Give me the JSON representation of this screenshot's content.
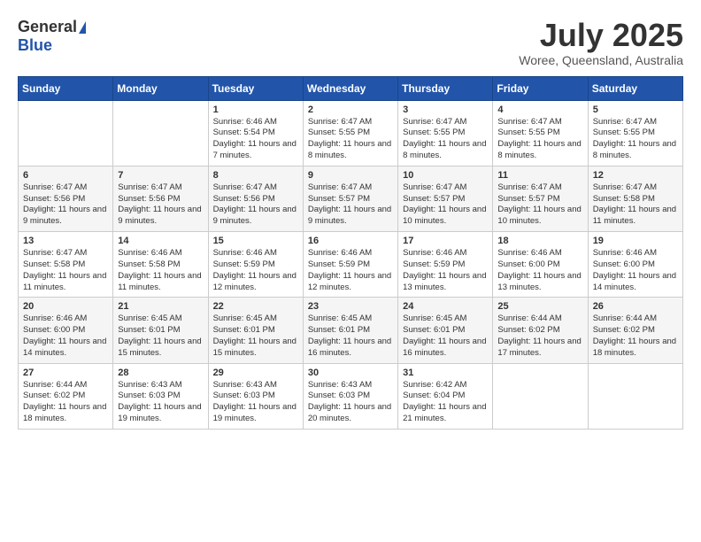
{
  "header": {
    "logo_general": "General",
    "logo_blue": "Blue",
    "month_year": "July 2025",
    "location": "Woree, Queensland, Australia"
  },
  "weekdays": [
    "Sunday",
    "Monday",
    "Tuesday",
    "Wednesday",
    "Thursday",
    "Friday",
    "Saturday"
  ],
  "weeks": [
    [
      {
        "day": "",
        "content": ""
      },
      {
        "day": "",
        "content": ""
      },
      {
        "day": "1",
        "content": "Sunrise: 6:46 AM\nSunset: 5:54 PM\nDaylight: 11 hours and 7 minutes."
      },
      {
        "day": "2",
        "content": "Sunrise: 6:47 AM\nSunset: 5:55 PM\nDaylight: 11 hours and 8 minutes."
      },
      {
        "day": "3",
        "content": "Sunrise: 6:47 AM\nSunset: 5:55 PM\nDaylight: 11 hours and 8 minutes."
      },
      {
        "day": "4",
        "content": "Sunrise: 6:47 AM\nSunset: 5:55 PM\nDaylight: 11 hours and 8 minutes."
      },
      {
        "day": "5",
        "content": "Sunrise: 6:47 AM\nSunset: 5:55 PM\nDaylight: 11 hours and 8 minutes."
      }
    ],
    [
      {
        "day": "6",
        "content": "Sunrise: 6:47 AM\nSunset: 5:56 PM\nDaylight: 11 hours and 9 minutes."
      },
      {
        "day": "7",
        "content": "Sunrise: 6:47 AM\nSunset: 5:56 PM\nDaylight: 11 hours and 9 minutes."
      },
      {
        "day": "8",
        "content": "Sunrise: 6:47 AM\nSunset: 5:56 PM\nDaylight: 11 hours and 9 minutes."
      },
      {
        "day": "9",
        "content": "Sunrise: 6:47 AM\nSunset: 5:57 PM\nDaylight: 11 hours and 9 minutes."
      },
      {
        "day": "10",
        "content": "Sunrise: 6:47 AM\nSunset: 5:57 PM\nDaylight: 11 hours and 10 minutes."
      },
      {
        "day": "11",
        "content": "Sunrise: 6:47 AM\nSunset: 5:57 PM\nDaylight: 11 hours and 10 minutes."
      },
      {
        "day": "12",
        "content": "Sunrise: 6:47 AM\nSunset: 5:58 PM\nDaylight: 11 hours and 11 minutes."
      }
    ],
    [
      {
        "day": "13",
        "content": "Sunrise: 6:47 AM\nSunset: 5:58 PM\nDaylight: 11 hours and 11 minutes."
      },
      {
        "day": "14",
        "content": "Sunrise: 6:46 AM\nSunset: 5:58 PM\nDaylight: 11 hours and 11 minutes."
      },
      {
        "day": "15",
        "content": "Sunrise: 6:46 AM\nSunset: 5:59 PM\nDaylight: 11 hours and 12 minutes."
      },
      {
        "day": "16",
        "content": "Sunrise: 6:46 AM\nSunset: 5:59 PM\nDaylight: 11 hours and 12 minutes."
      },
      {
        "day": "17",
        "content": "Sunrise: 6:46 AM\nSunset: 5:59 PM\nDaylight: 11 hours and 13 minutes."
      },
      {
        "day": "18",
        "content": "Sunrise: 6:46 AM\nSunset: 6:00 PM\nDaylight: 11 hours and 13 minutes."
      },
      {
        "day": "19",
        "content": "Sunrise: 6:46 AM\nSunset: 6:00 PM\nDaylight: 11 hours and 14 minutes."
      }
    ],
    [
      {
        "day": "20",
        "content": "Sunrise: 6:46 AM\nSunset: 6:00 PM\nDaylight: 11 hours and 14 minutes."
      },
      {
        "day": "21",
        "content": "Sunrise: 6:45 AM\nSunset: 6:01 PM\nDaylight: 11 hours and 15 minutes."
      },
      {
        "day": "22",
        "content": "Sunrise: 6:45 AM\nSunset: 6:01 PM\nDaylight: 11 hours and 15 minutes."
      },
      {
        "day": "23",
        "content": "Sunrise: 6:45 AM\nSunset: 6:01 PM\nDaylight: 11 hours and 16 minutes."
      },
      {
        "day": "24",
        "content": "Sunrise: 6:45 AM\nSunset: 6:01 PM\nDaylight: 11 hours and 16 minutes."
      },
      {
        "day": "25",
        "content": "Sunrise: 6:44 AM\nSunset: 6:02 PM\nDaylight: 11 hours and 17 minutes."
      },
      {
        "day": "26",
        "content": "Sunrise: 6:44 AM\nSunset: 6:02 PM\nDaylight: 11 hours and 18 minutes."
      }
    ],
    [
      {
        "day": "27",
        "content": "Sunrise: 6:44 AM\nSunset: 6:02 PM\nDaylight: 11 hours and 18 minutes."
      },
      {
        "day": "28",
        "content": "Sunrise: 6:43 AM\nSunset: 6:03 PM\nDaylight: 11 hours and 19 minutes."
      },
      {
        "day": "29",
        "content": "Sunrise: 6:43 AM\nSunset: 6:03 PM\nDaylight: 11 hours and 19 minutes."
      },
      {
        "day": "30",
        "content": "Sunrise: 6:43 AM\nSunset: 6:03 PM\nDaylight: 11 hours and 20 minutes."
      },
      {
        "day": "31",
        "content": "Sunrise: 6:42 AM\nSunset: 6:04 PM\nDaylight: 11 hours and 21 minutes."
      },
      {
        "day": "",
        "content": ""
      },
      {
        "day": "",
        "content": ""
      }
    ]
  ]
}
